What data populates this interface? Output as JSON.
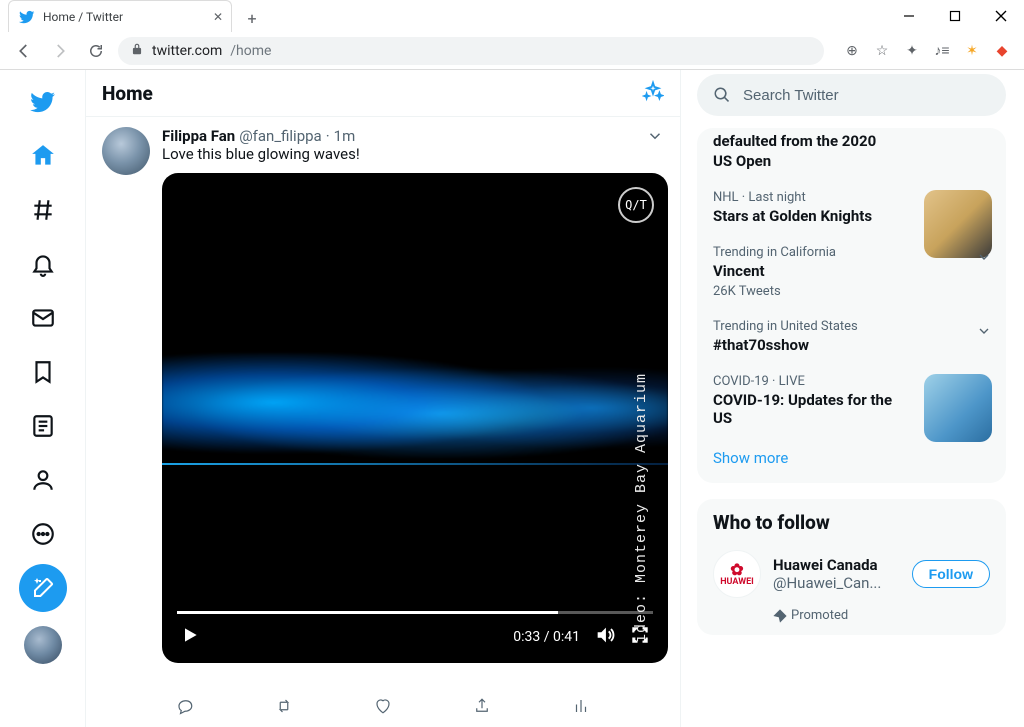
{
  "browser": {
    "tab_title": "Home / Twitter",
    "url_host": "twitter.com",
    "url_path": "/home"
  },
  "header": {
    "title": "Home"
  },
  "tweet": {
    "author_name": "Filippa Fan",
    "author_handle": "@fan_filippa",
    "separator": "·",
    "time": "1m",
    "text": "Love this blue glowing waves!",
    "video": {
      "badge": "Q/T",
      "credit": "ideo: Monterey Bay Aquarium",
      "current": "0:33",
      "duration": "0:41"
    }
  },
  "search": {
    "placeholder": "Search Twitter"
  },
  "trends": {
    "item0": {
      "topic": "US Open",
      "partial": "defaulted from the 2020"
    },
    "item1": {
      "ctx": "NHL · Last night",
      "topic": "Stars at Golden Knights"
    },
    "item2": {
      "ctx": "Trending in California",
      "topic": "Vincent",
      "count": "26K Tweets"
    },
    "item3": {
      "ctx": "Trending in United States",
      "topic": "#that70sshow"
    },
    "item4": {
      "ctx": "COVID-19 · LIVE",
      "topic": "COVID-19: Updates for the US"
    },
    "show_more": "Show more"
  },
  "wtf": {
    "heading": "Who to follow",
    "item0": {
      "name": "Huawei Canada",
      "handle": "@Huawei_Can...",
      "btn": "Follow",
      "logo_text": "HUAWEI"
    },
    "promoted": "Promoted"
  }
}
